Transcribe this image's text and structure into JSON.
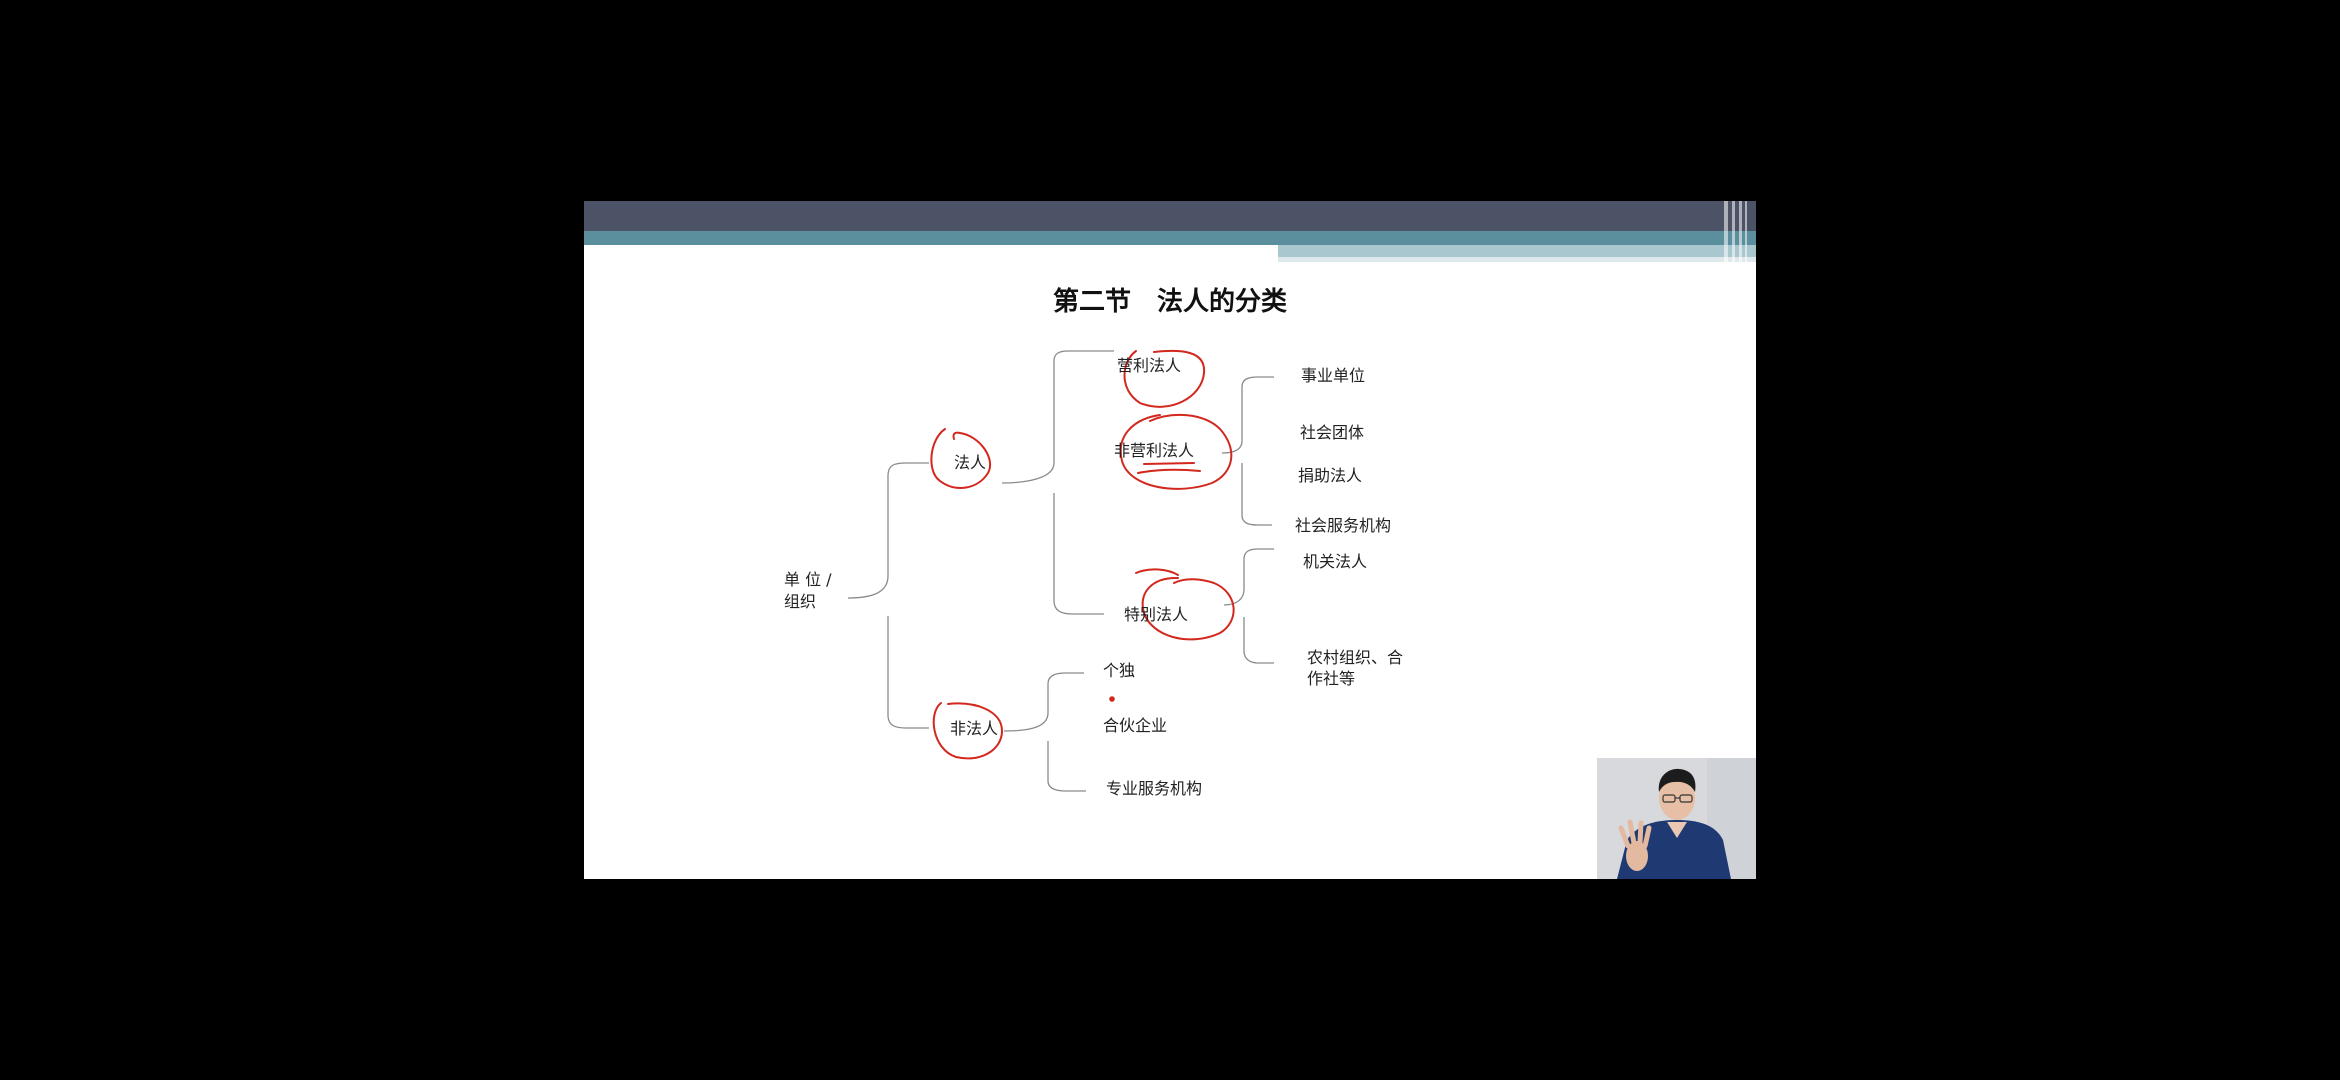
{
  "slide": {
    "title": "第二节　法人的分类",
    "root": {
      "line1": "单 位 /",
      "line2": "组织"
    },
    "level1": {
      "legal_person": "法人",
      "non_legal_person": "非法人"
    },
    "level2": {
      "profit": "营利法人",
      "non_profit": "非营利法人",
      "special": "特别法人",
      "sole": "个独",
      "partnership": "合伙企业",
      "professional": "专业服务机构"
    },
    "non_profit_children": [
      "事业单位",
      "社会团体",
      "捐助法人",
      "社会服务机构"
    ],
    "special_children": {
      "organ": "机关法人",
      "rural_line1": "农村组织、合",
      "rural_line2": "作社等"
    }
  },
  "colors": {
    "annotation": "#d2281e",
    "connector": "#8a8a8a",
    "banner_dark": "#4d5366",
    "banner_teal": "#5b8f9d"
  }
}
